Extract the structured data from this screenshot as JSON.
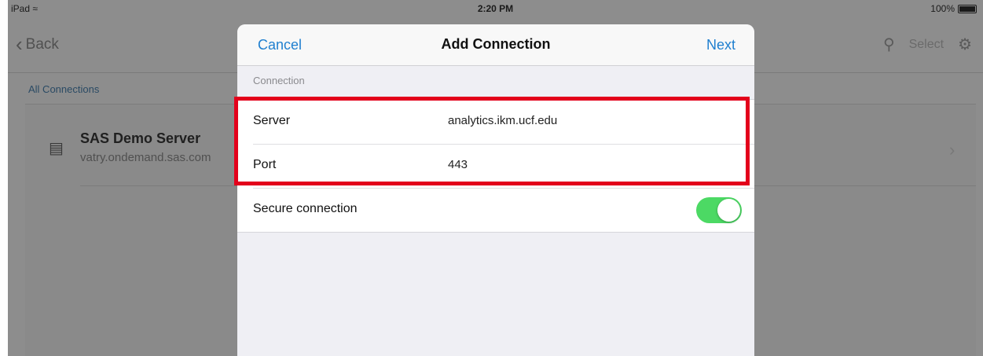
{
  "status_bar": {
    "device": "iPad",
    "wifi_icon": "wifi-icon",
    "time": "2:20 PM",
    "battery": "100%"
  },
  "nav": {
    "back_label": "Back",
    "select_label": "Select"
  },
  "breadcrumb": "All Connections",
  "connections": [
    {
      "name": "SAS Demo Server",
      "host": "vatry.ondemand.sas.com"
    }
  ],
  "modal": {
    "cancel_label": "Cancel",
    "title": "Add Connection",
    "next_label": "Next",
    "section_label": "Connection",
    "server_label": "Server",
    "server_value": "analytics.ikm.ucf.edu",
    "port_label": "Port",
    "port_value": "443",
    "secure_label": "Secure connection",
    "secure_on": true
  },
  "colors": {
    "accent": "#1f7fcf",
    "toggle_on": "#4cd964",
    "highlight": "#e3001b"
  }
}
